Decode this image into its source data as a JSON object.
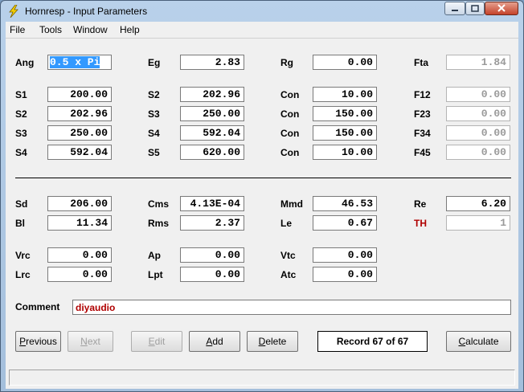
{
  "window": {
    "title": "Hornresp - Input Parameters"
  },
  "menu": [
    "File",
    "Tools",
    "Window",
    "Help"
  ],
  "row1": {
    "ang_label": "Ang",
    "ang_value": "0.5 x Pi",
    "eg_label": "Eg",
    "eg_value": "2.83",
    "rg_label": "Rg",
    "rg_value": "0.00",
    "fta_label": "Fta",
    "fta_value": "1.84"
  },
  "segments": [
    {
      "sa": "S1",
      "sa_v": "200.00",
      "sb": "S2",
      "sb_v": "202.96",
      "con": "Con",
      "con_v": "10.00",
      "f": "F12",
      "f_v": "0.00"
    },
    {
      "sa": "S2",
      "sa_v": "202.96",
      "sb": "S3",
      "sb_v": "250.00",
      "con": "Con",
      "con_v": "150.00",
      "f": "F23",
      "f_v": "0.00"
    },
    {
      "sa": "S3",
      "sa_v": "250.00",
      "sb": "S4",
      "sb_v": "592.04",
      "con": "Con",
      "con_v": "150.00",
      "f": "F34",
      "f_v": "0.00"
    },
    {
      "sa": "S4",
      "sa_v": "592.04",
      "sb": "S5",
      "sb_v": "620.00",
      "con": "Con",
      "con_v": "10.00",
      "f": "F45",
      "f_v": "0.00"
    }
  ],
  "driver": {
    "sd_label": "Sd",
    "sd": "206.00",
    "cms_label": "Cms",
    "cms": "4.13E-04",
    "mmd_label": "Mmd",
    "mmd": "46.53",
    "re_label": "Re",
    "re": "6.20",
    "bl_label": "Bl",
    "bl": "11.34",
    "rms_label": "Rms",
    "rms": "2.37",
    "le_label": "Le",
    "le": "0.67",
    "th_label": "TH",
    "th": "1"
  },
  "chamber": {
    "vrc_label": "Vrc",
    "vrc": "0.00",
    "ap_label": "Ap",
    "ap": "0.00",
    "vtc_label": "Vtc",
    "vtc": "0.00",
    "lrc_label": "Lrc",
    "lrc": "0.00",
    "lpt_label": "Lpt",
    "lpt": "0.00",
    "atc_label": "Atc",
    "atc": "0.00"
  },
  "comment": {
    "label": "Comment",
    "value": "diyaudio"
  },
  "buttons": {
    "previous_first": "P",
    "previous_rest": "revious",
    "next_first": "N",
    "next_rest": "ext",
    "edit_first": "E",
    "edit_rest": "dit",
    "add_first": "A",
    "add_rest": "dd",
    "delete_first": "D",
    "delete_rest": "elete",
    "calculate_first": "C",
    "calculate_rest": "alculate"
  },
  "record": "Record 67 of 67",
  "colors": {
    "accent_red": "#b00000",
    "selection": "#3399ff"
  },
  "icons": [
    "lightning-icon",
    "minimize-icon",
    "maximize-icon",
    "close-icon"
  ]
}
